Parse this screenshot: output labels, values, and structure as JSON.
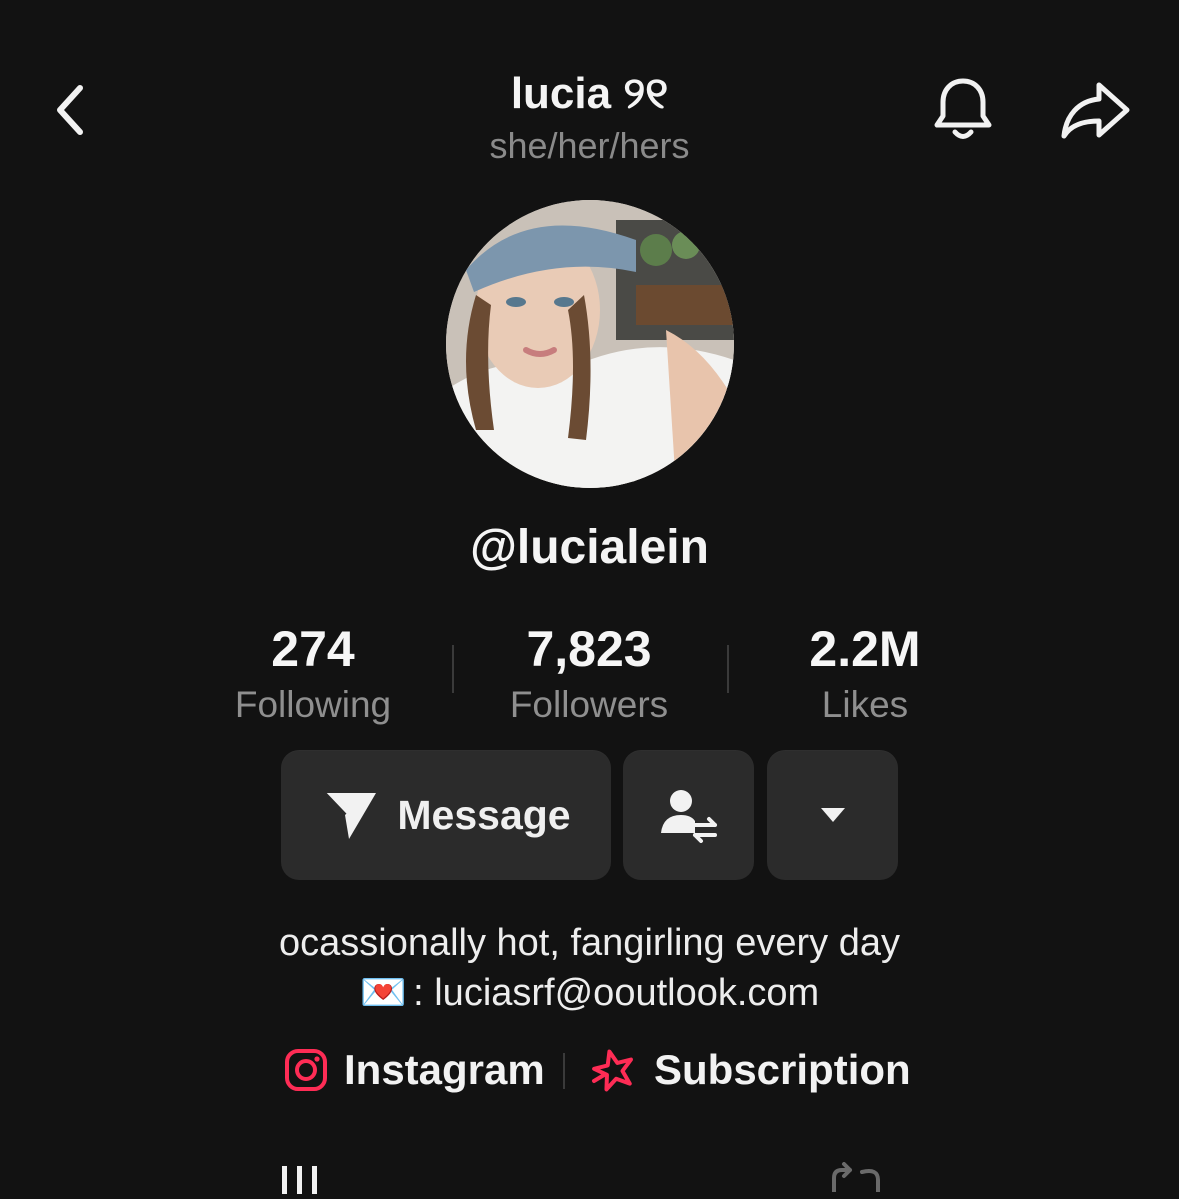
{
  "header": {
    "title": "lucia ୨୧",
    "pronouns": "she/her/hers",
    "back_icon": "chevron-left-icon",
    "bell_icon": "bell-icon",
    "share_icon": "share-arrow-icon"
  },
  "profile": {
    "handle": "@lucialein"
  },
  "stats": [
    {
      "value": "274",
      "label": "Following"
    },
    {
      "value": "7,823",
      "label": "Followers"
    },
    {
      "value": "2.2M",
      "label": "Likes"
    }
  ],
  "actions": {
    "message_label": "Message",
    "message_icon": "send-icon",
    "friend_icon": "switch-user-icon",
    "more_icon": "caret-down-icon"
  },
  "bio": {
    "line1": "ocassionally hot, fangirling every day",
    "line2_emoji": "💌",
    "line2_text": ": luciasrf@ooutlook.com"
  },
  "links": {
    "instagram_label": "Instagram",
    "subscription_label": "Subscription",
    "instagram_icon": "instagram-icon",
    "subscription_icon": "star-badge-icon"
  },
  "colors": {
    "background": "#121212",
    "button": "#2b2b2b",
    "accent": "#fe2c55",
    "muted_text": "#8f8f8f"
  }
}
